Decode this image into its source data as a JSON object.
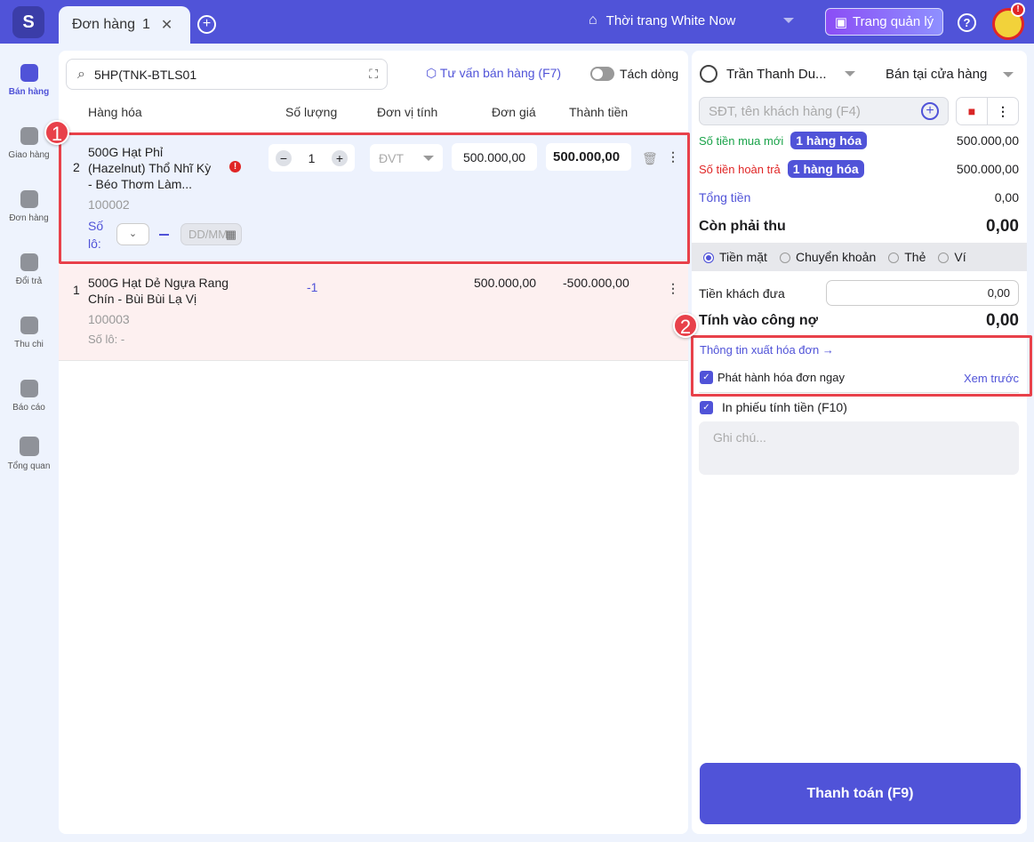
{
  "topbar": {
    "tab_label": "Đơn hàng",
    "tab_count": "1",
    "store_name": "Thời trang White Now",
    "manager_button": "Trang quản lý",
    "help": "?",
    "alert": "!"
  },
  "sidebar": {
    "items": [
      {
        "label": "Bán hàng",
        "icon": "shopping-bag-icon"
      },
      {
        "label": "Giao hàng",
        "icon": "truck-icon"
      },
      {
        "label": "Đơn hàng",
        "icon": "document-icon"
      },
      {
        "label": "Đổi trả",
        "icon": "return-icon"
      },
      {
        "label": "Thu chi",
        "icon": "wallet-icon"
      },
      {
        "label": "Báo cáo",
        "icon": "chart-icon"
      },
      {
        "label": "Tổng quan",
        "icon": "grid-icon"
      }
    ]
  },
  "search": {
    "value": "5HP(TNK-BTLS01"
  },
  "toolbar": {
    "consult": "Tư vấn bán hàng (F7)",
    "split": "Tách dòng"
  },
  "table": {
    "headers": [
      "Hàng hóa",
      "Số lượng",
      "Đơn vị tính",
      "Đơn giá",
      "Thành tiền"
    ],
    "rows": [
      {
        "index": "2",
        "name_lines": [
          "500G Hạt Phỉ",
          "(Hazelnut) Thổ Nhĩ Kỳ",
          "- Béo Thơm Làm..."
        ],
        "code": "100002",
        "qty": "1",
        "unit": "ĐVT",
        "price": "500.000,00",
        "total": "500.000,00",
        "lot_label_1": "Số",
        "lot_label_2": "lô:",
        "date_placeholder": "DD/MM",
        "warn": "!"
      },
      {
        "index": "1",
        "name_lines": [
          "500G Hạt Dẻ Ngựa Rang",
          "Chín - Bùi Bùi Lạ Vị"
        ],
        "code": "100003",
        "qty": "-1",
        "price": "500.000,00",
        "total": "-500.000,00",
        "lot": "Số lô: -"
      }
    ]
  },
  "annotations": [
    "1",
    "2"
  ],
  "right": {
    "staff": "Trần Thanh Du...",
    "channel": "Bán tại cửa hàng",
    "customer_placeholder": "SĐT, tên khách hàng (F4)",
    "new_label": "Số tiền mua mới",
    "new_pill": "1 hàng hóa",
    "new_value": "500.000,00",
    "refund_label": "Số tiền hoàn trả",
    "refund_pill": "1 hàng hóa",
    "refund_value": "500.000,00",
    "total_label": "Tổng tiền",
    "total_value": "0,00",
    "due_label": "Còn phải thu",
    "due_value": "0,00",
    "methods": [
      "Tiền mặt",
      "Chuyển khoản",
      "Thẻ",
      "Ví"
    ],
    "given_label": "Tiền khách đưa",
    "given_value": "0,00",
    "debt_label": "Tính vào công nợ",
    "debt_value": "0,00",
    "invoice_link": "Thông tin xuất hóa đơn →",
    "issue_label": "Phát hành hóa đơn ngay",
    "preview": "Xem trước",
    "print_label": "In phiếu tính tiền (F10)",
    "note_placeholder": "Ghi chú...",
    "pay_button": "Thanh toán (F9)"
  },
  "colors": {
    "brand": "#5053d8",
    "highlight": "#e8414a",
    "green": "#1aa34a",
    "red": "#e02626"
  }
}
